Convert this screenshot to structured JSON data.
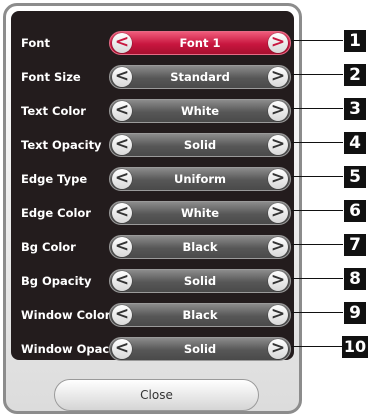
{
  "rows": [
    {
      "label": "Font",
      "value": "Font 1",
      "callout": "1"
    },
    {
      "label": "Font Size",
      "value": "Standard",
      "callout": "2"
    },
    {
      "label": "Text Color",
      "value": "White",
      "callout": "3"
    },
    {
      "label": "Text Opacity",
      "value": "Solid",
      "callout": "4"
    },
    {
      "label": "Edge Type",
      "value": "Uniform",
      "callout": "5"
    },
    {
      "label": "Edge Color",
      "value": "White",
      "callout": "6"
    },
    {
      "label": "Bg Color",
      "value": "Black",
      "callout": "7"
    },
    {
      "label": "Bg Opacity",
      "value": "Solid",
      "callout": "8"
    },
    {
      "label": "Window Color",
      "value": "Black",
      "callout": "9"
    },
    {
      "label": "Window Opacity",
      "value": "Solid",
      "callout": "10"
    }
  ],
  "arrows": {
    "left": "<",
    "right": ">"
  },
  "close_label": "Close",
  "selected_row": 0,
  "colors": {
    "selected": "#c8163f",
    "unselected": "#5a5a5a",
    "panel": "#231c1d"
  }
}
